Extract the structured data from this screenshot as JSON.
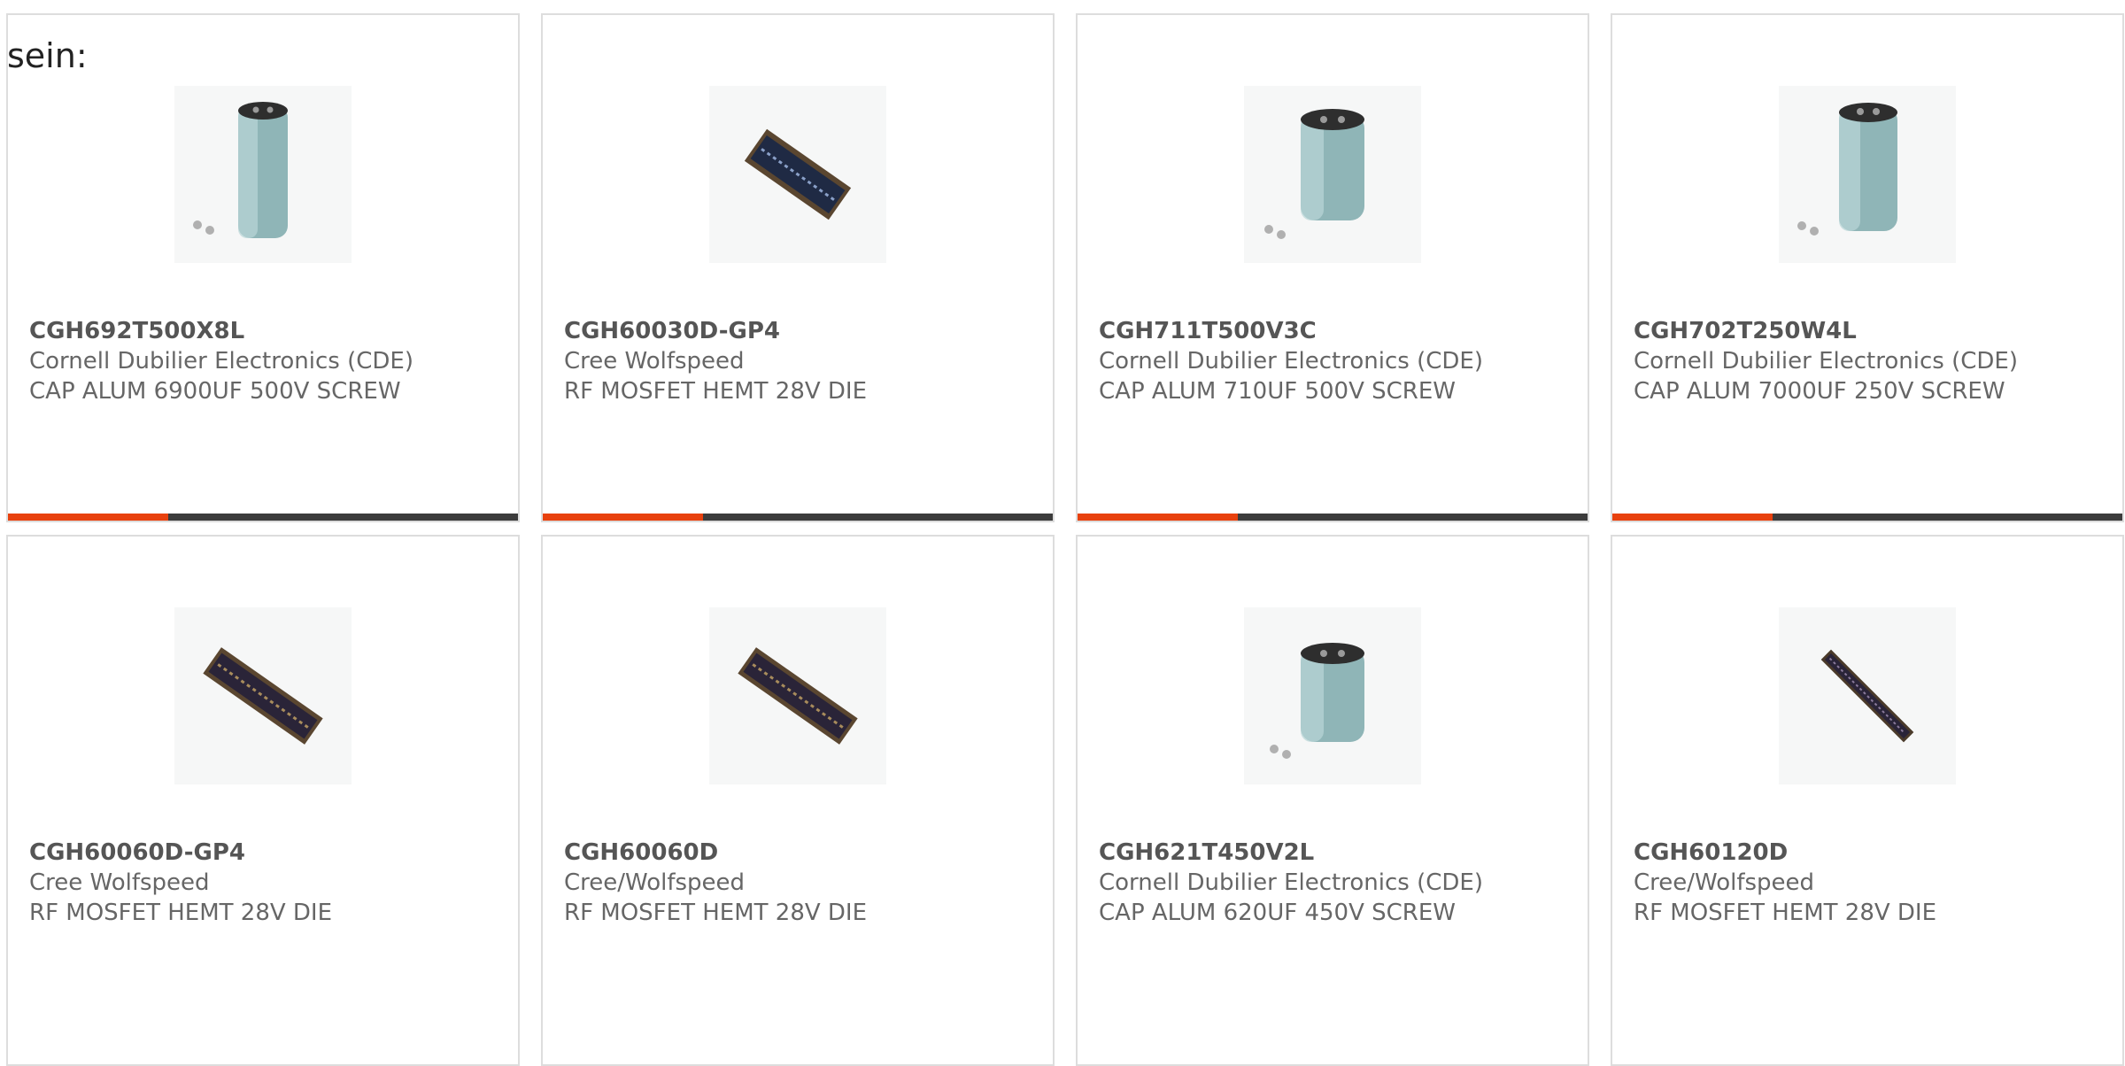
{
  "lead_text": "sein:",
  "accent_color": "#e8410e",
  "bar_color": "#3c3c3c",
  "products": [
    {
      "part_number": "CGH692T500X8L",
      "manufacturer": "Cornell Dubilier Electronics (CDE)",
      "description": "CAP ALUM 6900UF 500V SCREW",
      "image_icon": "tall-capacitor-icon"
    },
    {
      "part_number": "CGH60030D-GP4",
      "manufacturer": "Cree Wolfspeed",
      "description": "RF MOSFET HEMT 28V DIE",
      "image_icon": "die-chip-icon"
    },
    {
      "part_number": "CGH711T500V3C",
      "manufacturer": "Cornell Dubilier Electronics (CDE)",
      "description": "CAP ALUM 710UF 500V SCREW",
      "image_icon": "capacitor-icon"
    },
    {
      "part_number": "CGH702T250W4L",
      "manufacturer": "Cornell Dubilier Electronics (CDE)",
      "description": "CAP ALUM 7000UF 250V SCREW",
      "image_icon": "capacitor-icon"
    },
    {
      "part_number": "CGH60060D-GP4",
      "manufacturer": "Cree Wolfspeed",
      "description": "RF MOSFET HEMT 28V DIE",
      "image_icon": "die-chip-icon"
    },
    {
      "part_number": "CGH60060D",
      "manufacturer": "Cree/Wolfspeed",
      "description": "RF MOSFET HEMT 28V DIE",
      "image_icon": "die-chip-icon"
    },
    {
      "part_number": "CGH621T450V2L",
      "manufacturer": "Cornell Dubilier Electronics (CDE)",
      "description": "CAP ALUM 620UF 450V SCREW",
      "image_icon": "capacitor-icon"
    },
    {
      "part_number": "CGH60120D",
      "manufacturer": "Cree/Wolfspeed",
      "description": "RF MOSFET HEMT 28V DIE",
      "image_icon": "die-chip-icon"
    }
  ]
}
